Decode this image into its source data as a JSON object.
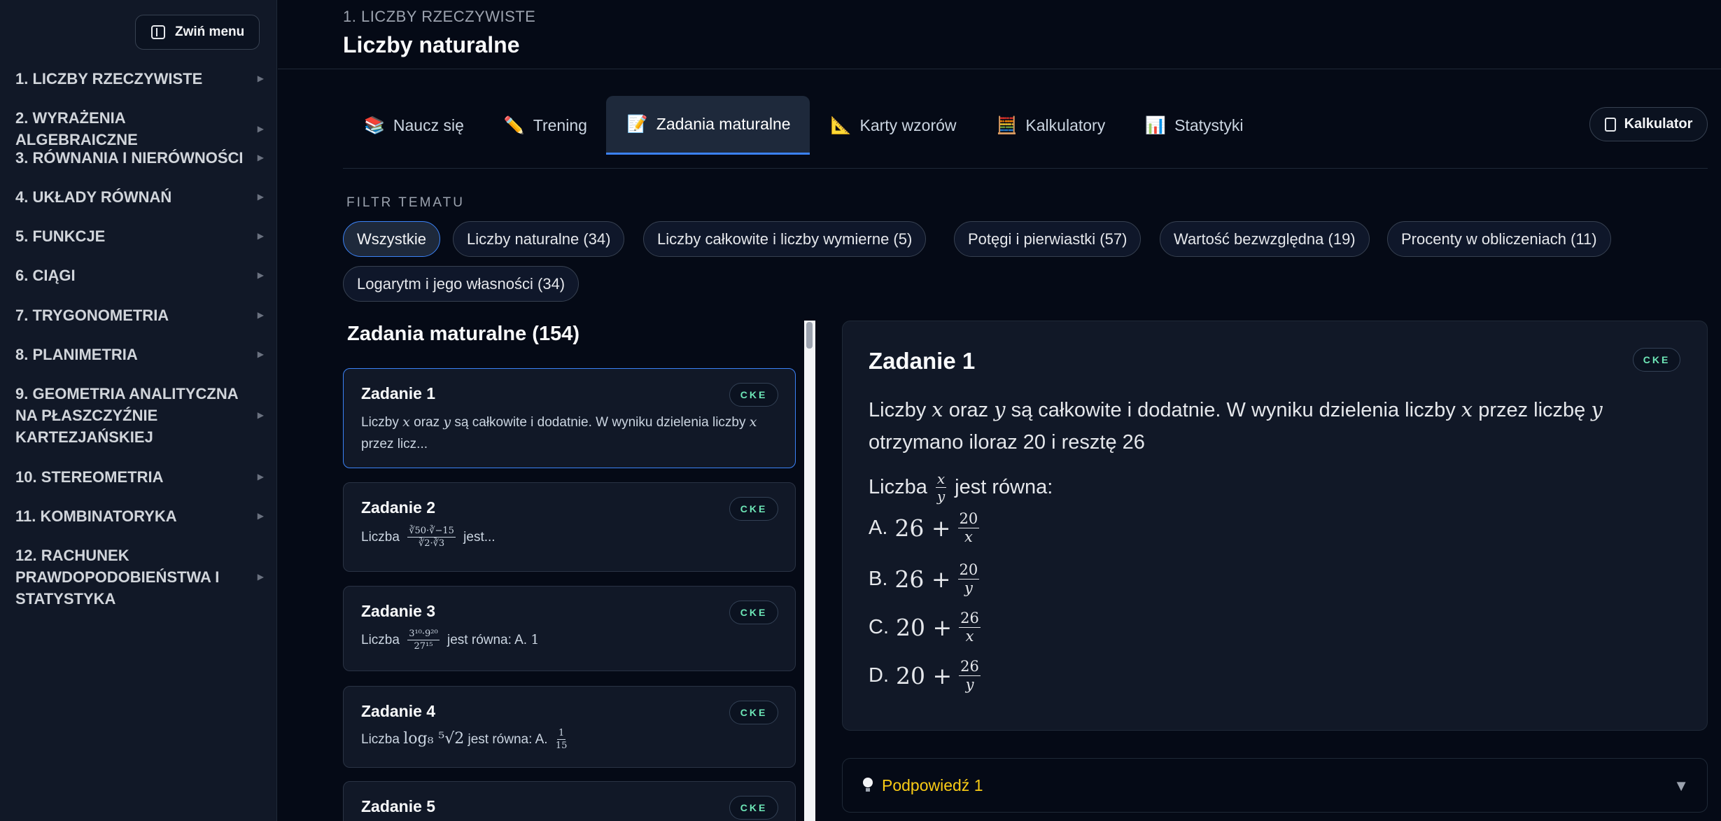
{
  "sidebar": {
    "collapse_label": "Zwiń menu",
    "items": [
      {
        "label": "1. LICZBY RZECZYWISTE"
      },
      {
        "label": "2. WYRAŻENIA ALGEBRAICZNE"
      },
      {
        "label": "3. RÓWNANIA I NIERÓWNOŚCI"
      },
      {
        "label": "4. UKŁADY RÓWNAŃ"
      },
      {
        "label": "5. FUNKCJE"
      },
      {
        "label": "6. CIĄGI"
      },
      {
        "label": "7. TRYGONOMETRIA"
      },
      {
        "label": "8. PLANIMETRIA"
      },
      {
        "label": "9. GEOMETRIA ANALITYCZNA NA PŁASZCZYŹNIE KARTEZJAŃSKIEJ"
      },
      {
        "label": "10. STEREOMETRIA"
      },
      {
        "label": "11. KOMBINATORYKA"
      },
      {
        "label": "12. RACHUNEK PRAWDOPODOBIEŃSTWA I STATYSTYKA"
      }
    ]
  },
  "header": {
    "breadcrumb": "1. LICZBY RZECZYWISTE",
    "title": "Liczby naturalne"
  },
  "tabs": [
    {
      "icon": "📚",
      "label": "Naucz się"
    },
    {
      "icon": "✏️",
      "label": "Trening"
    },
    {
      "icon": "📝",
      "label": "Zadania maturalne"
    },
    {
      "icon": "📐",
      "label": "Karty wzorów"
    },
    {
      "icon": "🧮",
      "label": "Kalkulatory"
    },
    {
      "icon": "📊",
      "label": "Statystyki"
    }
  ],
  "calculator_button": "Kalkulator",
  "filter": {
    "label": "FILTR TEMATU",
    "chips": [
      "Wszystkie",
      "Liczby naturalne (34)",
      "Liczby całkowite i liczby wymierne (5)",
      "Potęgi i pierwiastki (57)",
      "Wartość bezwzględna (19)",
      "Procenty w obliczeniach (11)",
      "Logarytm i jego własności (34)"
    ]
  },
  "list": {
    "title": "Zadania maturalne (154)",
    "badge": "CKE",
    "cards": [
      {
        "title": "Zadanie 1",
        "t1": "Liczby",
        "x": "x",
        "t2": "oraz",
        "y": "y",
        "t3": "są całkowite i dodatnie. W wyniku dzielenia liczby",
        "t4": "przez licz..."
      },
      {
        "title": "Zadanie 2",
        "pre": "Liczba",
        "num": "∛50·∛−15",
        "den": "∛2·∛3",
        "post": "jest..."
      },
      {
        "title": "Zadanie 3",
        "pre": "Liczba",
        "num": "3¹⁰·9²⁰",
        "den": "27¹⁵",
        "post": "jest równa: A.",
        "val": "1"
      },
      {
        "title": "Zadanie 4",
        "pre": "Liczba",
        "math": "log₈ ⁵√2",
        "post": "jest równa: A.",
        "num": "1",
        "den": "15"
      },
      {
        "title": "Zadanie 5"
      }
    ]
  },
  "detail": {
    "title": "Zadanie 1",
    "badge": "CKE",
    "p1a": "Liczby",
    "x": "x",
    "p1b": "oraz",
    "y": "y",
    "p1c": "są całkowite i dodatnie. W wyniku dzielenia liczby",
    "p1d": "przez liczbę",
    "p1e": "otrzymano iloraz 20 i resztę 26",
    "p2a": "Liczba",
    "p2b": "jest równa:",
    "options": [
      {
        "letter": "A.",
        "whole": "26 +",
        "num": "20",
        "den": "x"
      },
      {
        "letter": "B.",
        "whole": "26 +",
        "num": "20",
        "den": "y"
      },
      {
        "letter": "C.",
        "whole": "20 +",
        "num": "26",
        "den": "x"
      },
      {
        "letter": "D.",
        "whole": "20 +",
        "num": "26",
        "den": "y"
      }
    ]
  },
  "hint": {
    "label": "Podpowiedź 1",
    "toggle": "▼"
  }
}
